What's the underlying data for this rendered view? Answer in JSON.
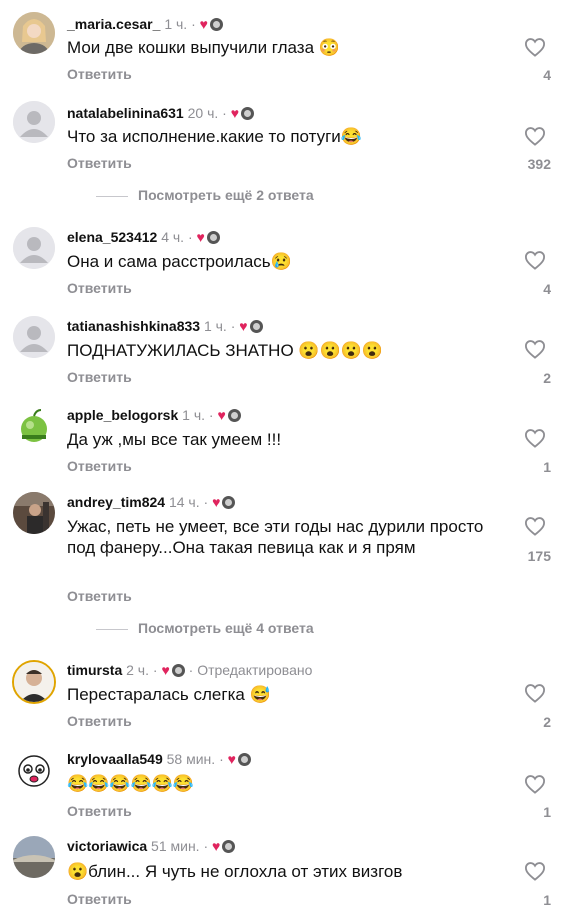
{
  "ui": {
    "reply_label": "Ответить",
    "edited_label": "· Отредактировано",
    "heart_symbol": "♥",
    "dot": "·"
  },
  "comments": [
    {
      "user": "_maria.cesar_",
      "time": "1 ч.",
      "text": "Мои две кошки выпучили глаза 😳",
      "likes": "4"
    },
    {
      "user": "natalabelinina631",
      "time": "20 ч.",
      "text": "Что за исполнение.какие то потуги😂",
      "likes": "392"
    },
    {
      "user": "elena_523412",
      "time": "4 ч.",
      "text": "Она и сама расстроилась😢",
      "likes": "4"
    },
    {
      "user": "tatianashishkina833",
      "time": "1 ч.",
      "text": "ПОДНАТУЖИЛАСЬ ЗНАТНО 😮😮😮😮",
      "likes": "2"
    },
    {
      "user": "apple_belogorsk",
      "time": "1 ч.",
      "text": "Да уж ,мы все так умеем !!!",
      "likes": "1"
    },
    {
      "user": "andrey_tim824",
      "time": "14 ч.",
      "text": "Ужас, петь не умеет, все эти годы нас дурили просто под фанеру...Она такая певица как и я прям",
      "likes": "175"
    },
    {
      "user": "timursta",
      "time": "2 ч.",
      "text": "Перестаралась слегка 😅",
      "likes": "2"
    },
    {
      "user": "krylovaalla549",
      "time": "58 мин.",
      "text": "😂😂😂😂😂😂",
      "likes": "1"
    },
    {
      "user": "victoriawica",
      "time": "51 мин.",
      "text": "😮блин... Я чуть не оглохла от этих визгов",
      "likes": "1"
    }
  ],
  "more_replies": [
    {
      "label": "Посмотреть ещё 2 ответа"
    },
    {
      "label": "Посмотреть ещё 4 ответа"
    }
  ]
}
